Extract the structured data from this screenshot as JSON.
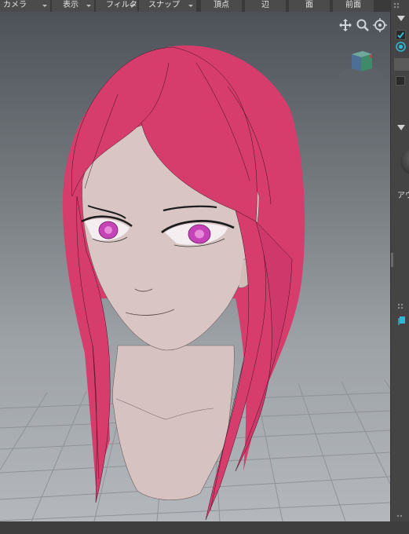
{
  "menubar": {
    "items": [
      {
        "label": "カメラ",
        "dropdown": true
      },
      {
        "label": "表示",
        "dropdown": true
      },
      {
        "label": "フィルタ",
        "dropdown": true
      },
      {
        "label": "スナップ",
        "dropdown": true
      },
      {
        "label": "頂点",
        "dropdown": false
      },
      {
        "label": "辺",
        "dropdown": false
      },
      {
        "label": "面",
        "dropdown": false
      },
      {
        "label": "前面",
        "dropdown": false
      }
    ]
  },
  "viewport": {
    "icons": [
      "move-view-icon",
      "zoom-view-icon",
      "orbit-view-icon"
    ],
    "model": "anime-girl-head",
    "colors": {
      "hair": "#d63c6c",
      "skin": "#d8c4c2",
      "iris": "#c042b2",
      "grid": "#8a8f95"
    }
  },
  "sidepanel": {
    "checkbox_checked": true,
    "radio_selected": true,
    "label_fragment": "アウ",
    "accent": "#2fb8d6"
  }
}
